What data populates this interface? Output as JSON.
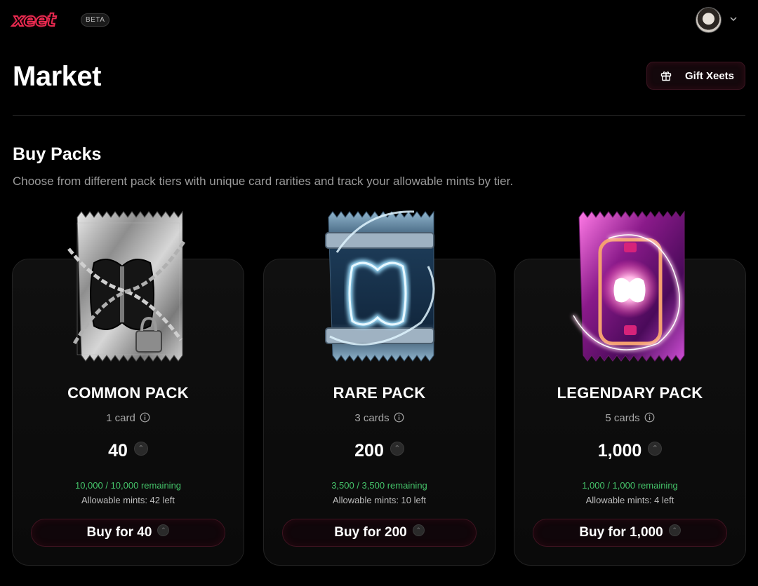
{
  "header": {
    "logo_text": "xeet",
    "beta_label": "BETA",
    "brand_color": "#e8294f"
  },
  "page": {
    "title": "Market",
    "gift_button_label": "Gift Xeets"
  },
  "section": {
    "title": "Buy Packs",
    "subtitle": "Choose from different pack tiers with unique card rarities and track your allowable mints by tier."
  },
  "packs": [
    {
      "name": "COMMON PACK",
      "card_count": "1 card",
      "price": "40",
      "remaining": "10,000 / 10,000 remaining",
      "mints": "Allowable mints: 42 left",
      "buy_label": "Buy for 40",
      "accent": "#c8c8c8"
    },
    {
      "name": "RARE PACK",
      "card_count": "3 cards",
      "price": "200",
      "remaining": "3,500 / 3,500 remaining",
      "mints": "Allowable mints: 10 left",
      "buy_label": "Buy for 200",
      "accent": "#6fc6ff"
    },
    {
      "name": "LEGENDARY PACK",
      "card_count": "5 cards",
      "price": "1,000",
      "remaining": "1,000 / 1,000 remaining",
      "mints": "Allowable mints: 4 left",
      "buy_label": "Buy for 1,000",
      "accent": "#ff4fd8"
    }
  ],
  "colors": {
    "remaining_green": "#45c46a",
    "muted_text": "#9a9a9a"
  }
}
